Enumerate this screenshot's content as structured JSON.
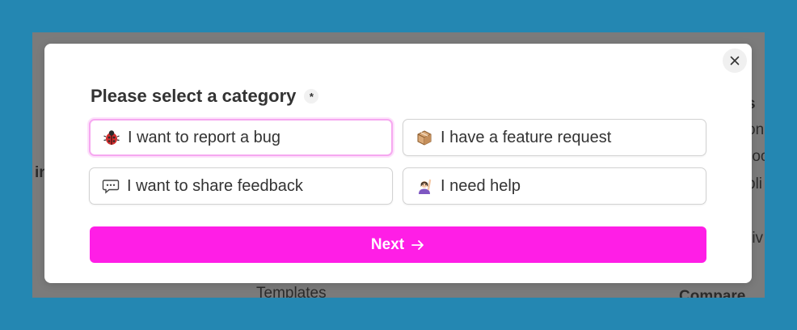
{
  "background_page": {
    "fragments": [
      "in",
      "Templates",
      "Compare",
      "s",
      "on",
      "roo",
      "bli",
      "riv"
    ]
  },
  "modal": {
    "question_label": "Please select a category",
    "required_marker": "*",
    "options": [
      {
        "emoji": "lady-beetle-icon",
        "label": "I want to report a bug",
        "selected": true
      },
      {
        "emoji": "package-icon",
        "label": "I have a feature request",
        "selected": false
      },
      {
        "emoji": "speech-balloon-icon",
        "label": "I want to share feedback",
        "selected": false
      },
      {
        "emoji": "person-raising-hand-icon",
        "label": "I need help",
        "selected": false
      }
    ],
    "next_label": "Next",
    "close_icon": "close-icon"
  },
  "colors": {
    "page_background": "#2487b2",
    "overlay": "#7b7b7b",
    "accent": "#ff1ee6",
    "selected_border": "#f6a8f0"
  }
}
